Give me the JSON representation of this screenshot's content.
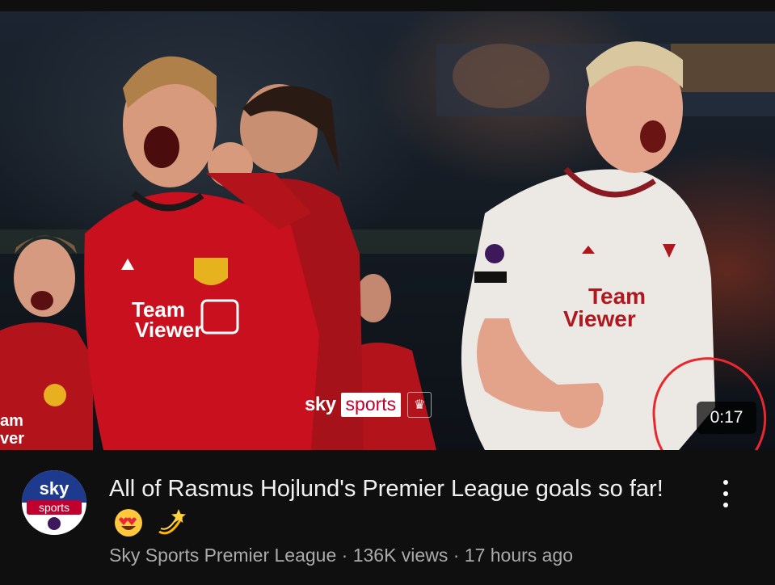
{
  "video": {
    "duration": "0:17",
    "title": "All of Rasmus Hojlund's Premier League goals so far!",
    "title_emojis": [
      "heart-eyes-emoji",
      "dizzy-star-emoji"
    ],
    "channel": "Sky Sports Premier League",
    "views": "136K views",
    "separator": "·",
    "age": "17 hours ago"
  },
  "thumbnail": {
    "brand_sky": "sky",
    "brand_sports": "sports",
    "jersey_sponsor": "TeamViewer",
    "highlight_color": "#e8282e",
    "kit_home_color": "#c8101e",
    "kit_away_color": "#ece8e4"
  },
  "channel_avatar": {
    "sky": "sky",
    "sports": "sports"
  },
  "icons": {
    "menu": "more-vert-icon",
    "league": "premier-league-icon"
  }
}
